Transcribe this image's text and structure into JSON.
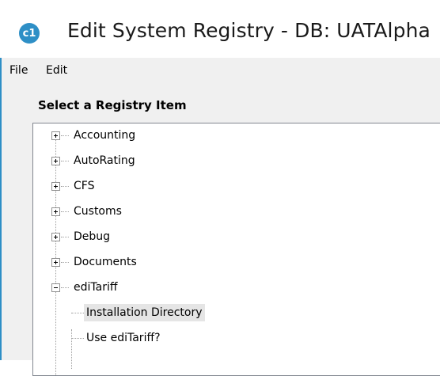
{
  "window": {
    "icon_glyph": "c1",
    "title": "Edit System Registry - DB: UATAlpha"
  },
  "menu": {
    "items": [
      "File",
      "Edit"
    ]
  },
  "section": {
    "label": "Select a Registry Item"
  },
  "tree": {
    "items": [
      {
        "label": "Accounting",
        "expander": "plus"
      },
      {
        "label": "AutoRating",
        "expander": "plus"
      },
      {
        "label": "CFS",
        "expander": "plus"
      },
      {
        "label": "Customs",
        "expander": "plus"
      },
      {
        "label": "Debug",
        "expander": "plus"
      },
      {
        "label": "Documents",
        "expander": "plus"
      },
      {
        "label": "ediTariff",
        "expander": "minus",
        "children": [
          {
            "label": "Installation Directory",
            "selected": true
          },
          {
            "label": "Use ediTariff?"
          }
        ]
      }
    ]
  },
  "icons": {
    "app": "app-logo-icon",
    "expand": "plus-box-icon",
    "collapse": "minus-box-icon"
  },
  "colors": {
    "accent": "#2e8fc6",
    "selection": "#e5e5e5"
  }
}
